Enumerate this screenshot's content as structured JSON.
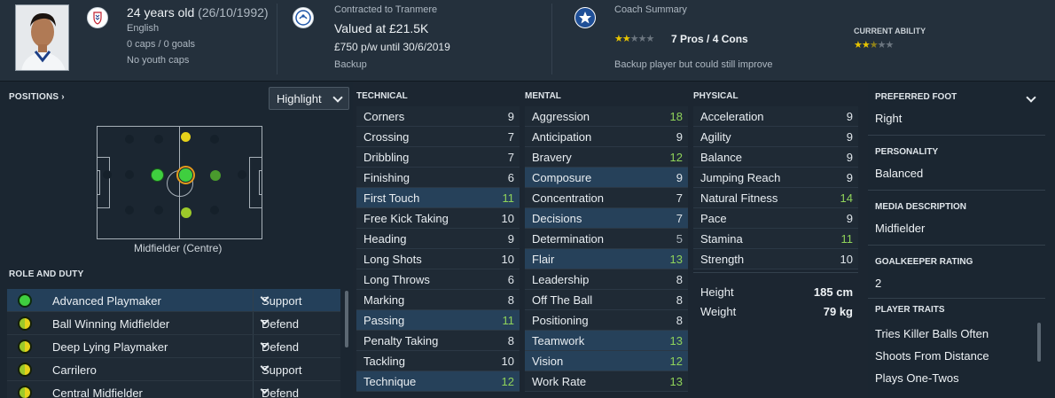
{
  "header": {
    "age": "24 years old",
    "dob": "(26/10/1992)",
    "nationality": "English",
    "caps": "0 caps / 0 goals",
    "youth_caps": "No youth caps",
    "contract_label": "Contracted to Tranmere",
    "value": "Valued at £21.5K",
    "wage": "£750 p/w until 30/6/2019",
    "squad_status": "Backup",
    "coach_summary_label": "Coach Summary",
    "coach_rating_text": "7 Pros / 4 Cons",
    "coach_stars": 2,
    "current_ability_label": "CURRENT ABILITY",
    "current_ability_stars": 2.5,
    "coach_comment": "Backup player but could still improve"
  },
  "pitch_panel": {
    "positions_label": "POSITIONS",
    "highlight_label": "Highlight",
    "position_name": "Midfielder (Centre)",
    "role_duty_label": "ROLE AND DUTY"
  },
  "roles": [
    {
      "name": "Advanced Playmaker",
      "duty": "Support",
      "icon": "full-green"
    },
    {
      "name": "Ball Winning Midfielder",
      "duty": "Defend",
      "icon": "half-yellow-green"
    },
    {
      "name": "Deep Lying Playmaker",
      "duty": "Defend",
      "icon": "half-yellow-green"
    },
    {
      "name": "Carrilero",
      "duty": "Support",
      "icon": "half-yellow-green"
    },
    {
      "name": "Central Midfielder",
      "duty": "Defend",
      "icon": "half-yellow-green"
    }
  ],
  "attributes": {
    "technical_label": "TECHNICAL",
    "mental_label": "MENTAL",
    "physical_label": "PHYSICAL",
    "technical": [
      {
        "name": "Corners",
        "value": "9"
      },
      {
        "name": "Crossing",
        "value": "7"
      },
      {
        "name": "Dribbling",
        "value": "7"
      },
      {
        "name": "Finishing",
        "value": "6"
      },
      {
        "name": "First Touch",
        "value": "11"
      },
      {
        "name": "Free Kick Taking",
        "value": "10"
      },
      {
        "name": "Heading",
        "value": "9"
      },
      {
        "name": "Long Shots",
        "value": "10"
      },
      {
        "name": "Long Throws",
        "value": "6"
      },
      {
        "name": "Marking",
        "value": "8"
      },
      {
        "name": "Passing",
        "value": "11"
      },
      {
        "name": "Penalty Taking",
        "value": "8"
      },
      {
        "name": "Tackling",
        "value": "10"
      },
      {
        "name": "Technique",
        "value": "12"
      }
    ],
    "mental": [
      {
        "name": "Aggression",
        "value": "18"
      },
      {
        "name": "Anticipation",
        "value": "9"
      },
      {
        "name": "Bravery",
        "value": "12"
      },
      {
        "name": "Composure",
        "value": "9"
      },
      {
        "name": "Concentration",
        "value": "7"
      },
      {
        "name": "Decisions",
        "value": "7"
      },
      {
        "name": "Determination",
        "value": "5"
      },
      {
        "name": "Flair",
        "value": "13"
      },
      {
        "name": "Leadership",
        "value": "8"
      },
      {
        "name": "Off The Ball",
        "value": "8"
      },
      {
        "name": "Positioning",
        "value": "8"
      },
      {
        "name": "Teamwork",
        "value": "13"
      },
      {
        "name": "Vision",
        "value": "12"
      },
      {
        "name": "Work Rate",
        "value": "13"
      }
    ],
    "physical": [
      {
        "name": "Acceleration",
        "value": "9"
      },
      {
        "name": "Agility",
        "value": "9"
      },
      {
        "name": "Balance",
        "value": "9"
      },
      {
        "name": "Jumping Reach",
        "value": "9"
      },
      {
        "name": "Natural Fitness",
        "value": "14"
      },
      {
        "name": "Pace",
        "value": "9"
      },
      {
        "name": "Stamina",
        "value": "11"
      },
      {
        "name": "Strength",
        "value": "10"
      }
    ],
    "height_label": "Height",
    "height_value": "185 cm",
    "weight_label": "Weight",
    "weight_value": "79 kg"
  },
  "right_panel": {
    "preferred_foot_label": "PREFERRED FOOT",
    "preferred_foot": "Right",
    "personality_label": "PERSONALITY",
    "personality": "Balanced",
    "media_label": "MEDIA DESCRIPTION",
    "media": "Midfielder",
    "gk_label": "GOALKEEPER RATING",
    "gk_rating": "2",
    "traits_label": "PLAYER TRAITS",
    "traits": [
      "Tries Killer Balls Often",
      "Shoots From Distance",
      "Plays One-Twos"
    ]
  },
  "colors": {
    "good_value": "#8fd35a",
    "highlight_row": "#26415a",
    "star": "#e8c400",
    "natural_position": "#3fcf3f",
    "accomplished_position": "#e6d21a"
  }
}
